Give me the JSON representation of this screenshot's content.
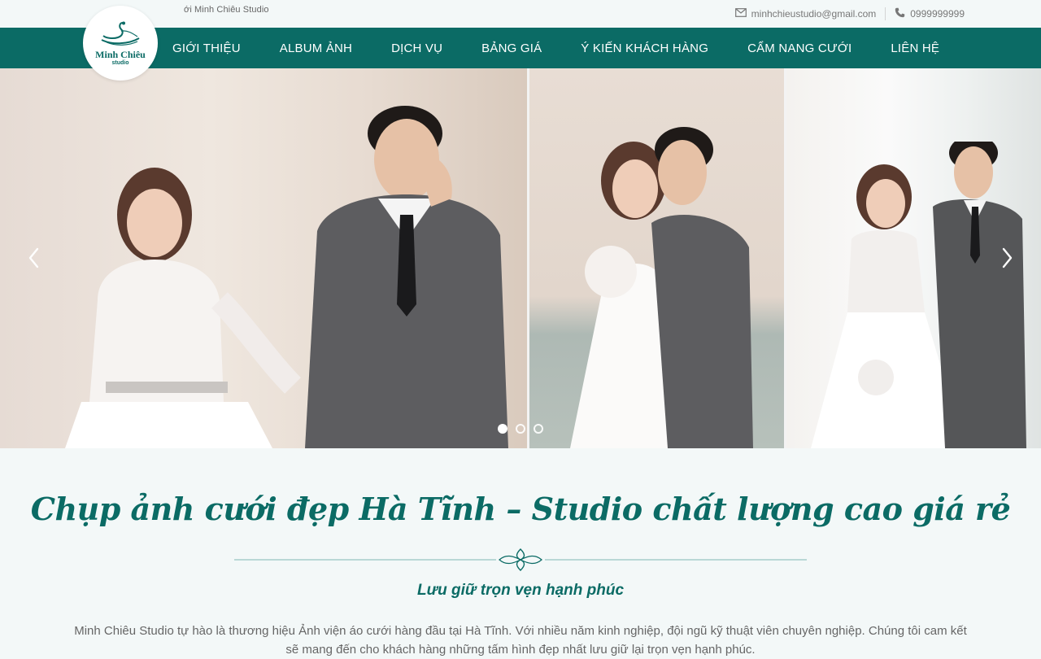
{
  "topbar": {
    "marquee": "ới Minh Chiêu Studio",
    "email": "minhchieustudio@gmail.com",
    "phone": "0999999999",
    "email_icon": "mail-icon",
    "phone_icon": "phone-icon"
  },
  "logo": {
    "brand": "Minh Chiêu",
    "sub": "studio"
  },
  "nav": {
    "items": [
      {
        "label": "GIỚI THIỆU"
      },
      {
        "label": "ALBUM ẢNH"
      },
      {
        "label": "DỊCH VỤ"
      },
      {
        "label": "BẢNG GIÁ"
      },
      {
        "label": "Ý KIẾN KHÁCH HÀNG"
      },
      {
        "label": "CẨM NANG CƯỚI"
      },
      {
        "label": "LIÊN HỆ"
      }
    ]
  },
  "slider": {
    "prev_icon": "chevron-left-icon",
    "next_icon": "chevron-right-icon",
    "slide_count": 3,
    "active_slide": 1
  },
  "intro": {
    "title": "Chụp ảnh cưới đẹp Hà Tĩnh – Studio chất lượng cao giá rẻ",
    "subtitle": "Lưu giữ trọn vẹn hạnh phúc",
    "paragraph": "Minh Chiêu Studio tự hào là thương hiệu Ảnh viện áo cưới hàng đầu tại Hà Tĩnh. Với nhiều năm kinh nghiệp, đội ngũ kỹ thuật viên chuyên nghiệp. Chúng tôi cam kết sẽ mang đến cho khách hàng những tấm hình đẹp nhất lưu giữ lại trọn vẹn hạnh phúc."
  },
  "colors": {
    "brand": "#0b6b65",
    "background": "#f3f8f8"
  }
}
